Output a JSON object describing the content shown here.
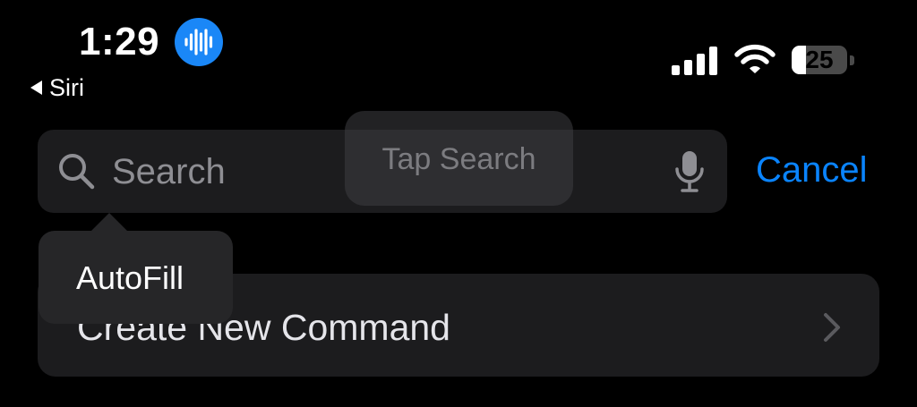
{
  "status_bar": {
    "time": "1:29",
    "back_label": "Siri",
    "battery_level": "25",
    "battery_fraction": 0.25,
    "icons": [
      "siri-waveform-icon",
      "cellular-signal-icon",
      "wifi-icon",
      "battery-icon"
    ]
  },
  "search": {
    "placeholder": "Search",
    "cancel_label": "Cancel",
    "icons": [
      "search-icon",
      "microphone-icon"
    ]
  },
  "tap_hint": {
    "label": "Tap Search"
  },
  "autofill": {
    "label": "AutoFill"
  },
  "list": {
    "items": [
      {
        "label": "Create New Command",
        "icon": "chevron-right-icon"
      }
    ]
  },
  "colors": {
    "background": "#000000",
    "accent": "#0a84ff",
    "siri_badge": "#1a87f7",
    "field_background": "#1c1c1e",
    "placeholder_text": "#8e8e93"
  }
}
